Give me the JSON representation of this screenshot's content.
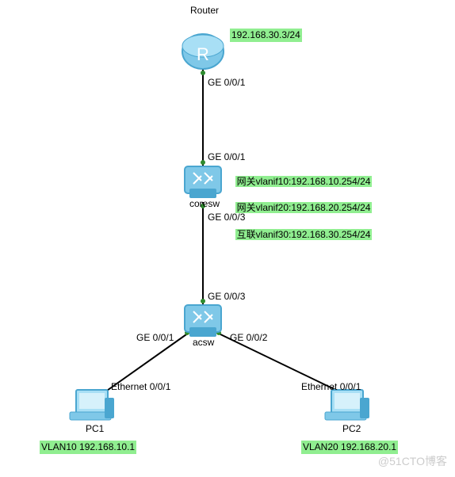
{
  "devices": {
    "router": {
      "name": "Router",
      "ip": "192.168.30.3/24"
    },
    "coresw": {
      "name": "coresw"
    },
    "acsw": {
      "name": "acsw"
    },
    "pc1": {
      "name": "PC1",
      "vlan": "VLAN10 192.168.10.1"
    },
    "pc2": {
      "name": "PC2",
      "vlan": "VLAN20 192.168.20.1"
    }
  },
  "coresw_info": {
    "line1": "网关vlanif10:192.168.10.254/24",
    "line2": "网关vlanif20:192.168.20.254/24",
    "line3": "互联vlanif30:192.168.30.254/24"
  },
  "ports": {
    "router_ge001": "GE 0/0/1",
    "coresw_ge001": "GE 0/0/1",
    "coresw_ge003": "GE 0/0/3",
    "acsw_ge003": "GE 0/0/3",
    "acsw_ge001": "GE 0/0/1",
    "acsw_ge002": "GE 0/0/2",
    "pc1_eth001": "Ethernet 0/0/1",
    "pc2_eth001": "Ethernet 0/0/1"
  },
  "watermark": "@51CTO博客",
  "diagram_data": {
    "type": "network-topology",
    "nodes": [
      {
        "id": "Router",
        "type": "router",
        "ip": "192.168.30.3/24"
      },
      {
        "id": "coresw",
        "type": "l3-switch",
        "interfaces": [
          {
            "name": "vlanif10",
            "role": "网关",
            "ip": "192.168.10.254/24"
          },
          {
            "name": "vlanif20",
            "role": "网关",
            "ip": "192.168.20.254/24"
          },
          {
            "name": "vlanif30",
            "role": "互联",
            "ip": "192.168.30.254/24"
          }
        ]
      },
      {
        "id": "acsw",
        "type": "l2-switch"
      },
      {
        "id": "PC1",
        "type": "pc",
        "vlan": "VLAN10",
        "ip": "192.168.10.1"
      },
      {
        "id": "PC2",
        "type": "pc",
        "vlan": "VLAN20",
        "ip": "192.168.20.1"
      }
    ],
    "links": [
      {
        "from": "Router",
        "from_port": "GE 0/0/1",
        "to": "coresw",
        "to_port": "GE 0/0/1"
      },
      {
        "from": "coresw",
        "from_port": "GE 0/0/3",
        "to": "acsw",
        "to_port": "GE 0/0/3"
      },
      {
        "from": "acsw",
        "from_port": "GE 0/0/1",
        "to": "PC1",
        "to_port": "Ethernet 0/0/1"
      },
      {
        "from": "acsw",
        "from_port": "GE 0/0/2",
        "to": "PC2",
        "to_port": "Ethernet 0/0/1"
      }
    ]
  }
}
